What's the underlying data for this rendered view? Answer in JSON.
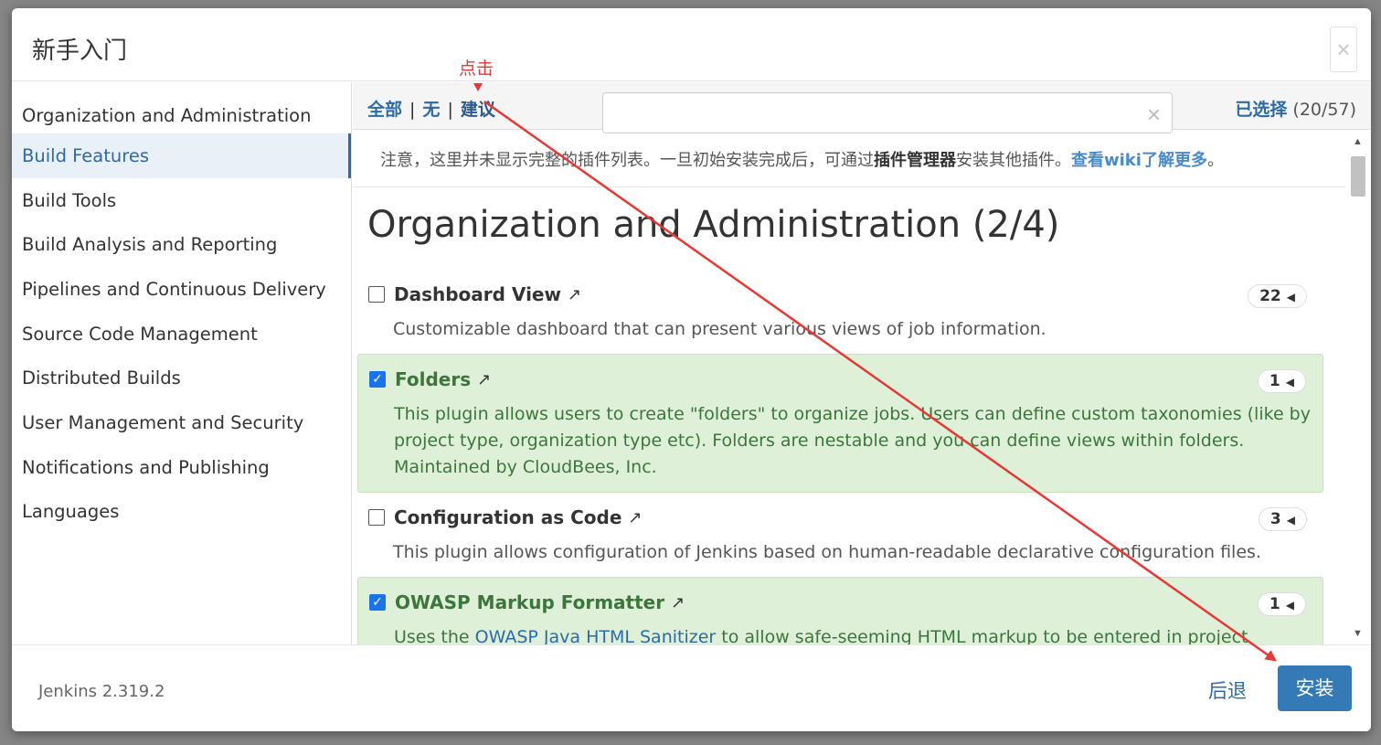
{
  "dialog": {
    "title": "新手入门"
  },
  "icons": {
    "close": "×",
    "clear": "×",
    "external": "↗",
    "caret": "◀",
    "scroll_up": "▲",
    "scroll_down": "▼"
  },
  "sidebar": {
    "items": [
      {
        "label": "Organization and Administration"
      },
      {
        "label": "Build Features"
      },
      {
        "label": "Build Tools"
      },
      {
        "label": "Build Analysis and Reporting"
      },
      {
        "label": "Pipelines and Continuous Delivery"
      },
      {
        "label": "Source Code Management"
      },
      {
        "label": "Distributed Builds"
      },
      {
        "label": "User Management and Security"
      },
      {
        "label": "Notifications and Publishing"
      },
      {
        "label": "Languages"
      }
    ],
    "active_index": 1
  },
  "toolbar": {
    "filter_all": "全部",
    "filter_none": "无",
    "filter_suggested": "建议",
    "separator": "|",
    "search_value": "",
    "selected_label": "已选择",
    "selected_count": "(20/57)"
  },
  "notice": {
    "part1": "注意，这里并未显示完整的插件列表。一旦初始安装完成后，可通过",
    "bold": "插件管理器",
    "part2": "安装其他插件。",
    "link": "查看wiki了解更多",
    "end": "。"
  },
  "section": {
    "title": "Organization and Administration (2/4)"
  },
  "plugins": [
    {
      "name": "Dashboard View",
      "deps": "22",
      "selected": false,
      "desc": "Customizable dashboard that can present various views of job information."
    },
    {
      "name": "Folders",
      "deps": "1",
      "selected": true,
      "desc": "This plugin allows users to create \"folders\" to organize jobs. Users can define custom taxonomies (like by project type, organization type etc). Folders are nestable and you can define views within folders. Maintained by CloudBees, Inc."
    },
    {
      "name": "Configuration as Code",
      "deps": "3",
      "selected": false,
      "desc": "This plugin allows configuration of Jenkins based on human-readable declarative configuration files."
    },
    {
      "name": "OWASP Markup Formatter",
      "deps": "1",
      "selected": true,
      "desc_prefix": "Uses the ",
      "desc_link": "OWASP Java HTML Sanitizer",
      "desc_suffix": " to allow safe-seeming HTML markup to be entered in project descriptions and the like."
    }
  ],
  "footer": {
    "version": "Jenkins 2.319.2",
    "back_label": "后退",
    "install_label": "安装"
  },
  "annotation": {
    "label": "点击",
    "color": "#e53935"
  },
  "colors": {
    "accent": "#337ab7",
    "link": "#2d6aa8",
    "selected_bg": "#dff0d8",
    "selected_text": "#3c763d"
  }
}
